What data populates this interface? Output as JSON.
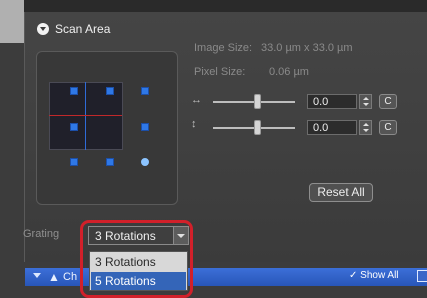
{
  "section": {
    "title": "Scan Area"
  },
  "info": {
    "image_size_label": "Image Size:",
    "image_size_value": "33.0 µm x 33.0 µm",
    "pixel_size_label": "Pixel Size:",
    "pixel_size_value": "0.06 µm"
  },
  "offset_x": {
    "icon": "↔",
    "value": "0.0",
    "c_label": "C"
  },
  "offset_y": {
    "icon": "↕",
    "value": "0.0",
    "c_label": "C"
  },
  "reset_all": "Reset All",
  "grating": {
    "label": "Grating",
    "selected": "3 Rotations",
    "options": [
      "3 Rotations",
      "5 Rotations"
    ]
  },
  "bottom_bar": {
    "title": "Ch",
    "show_all": "✓ Show All"
  },
  "colors": {
    "accent_blue": "#2f78e6",
    "highlight_red": "#d2202a",
    "header_blue": "#3465b8"
  }
}
